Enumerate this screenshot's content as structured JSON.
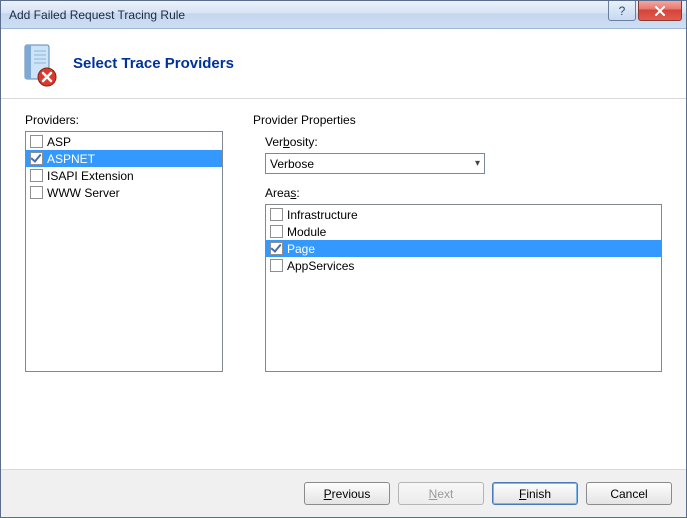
{
  "window": {
    "title": "Add Failed Request Tracing Rule"
  },
  "header": {
    "title": "Select Trace Providers"
  },
  "providers": {
    "label": "Providers:",
    "items": [
      {
        "label": "ASP",
        "checked": false,
        "selected": false
      },
      {
        "label": "ASPNET",
        "checked": true,
        "selected": true
      },
      {
        "label": "ISAPI Extension",
        "checked": false,
        "selected": false
      },
      {
        "label": "WWW Server",
        "checked": false,
        "selected": false
      }
    ]
  },
  "properties": {
    "title": "Provider Properties",
    "verbosity_label": "Verbosity:",
    "verbosity_value": "Verbose",
    "areas_label": "Areas:",
    "areas": [
      {
        "label": "Infrastructure",
        "checked": false,
        "selected": false
      },
      {
        "label": "Module",
        "checked": false,
        "selected": false
      },
      {
        "label": "Page",
        "checked": true,
        "selected": true
      },
      {
        "label": "AppServices",
        "checked": false,
        "selected": false
      }
    ]
  },
  "buttons": {
    "previous": "Previous",
    "next": "Next",
    "finish": "Finish",
    "cancel": "Cancel"
  }
}
